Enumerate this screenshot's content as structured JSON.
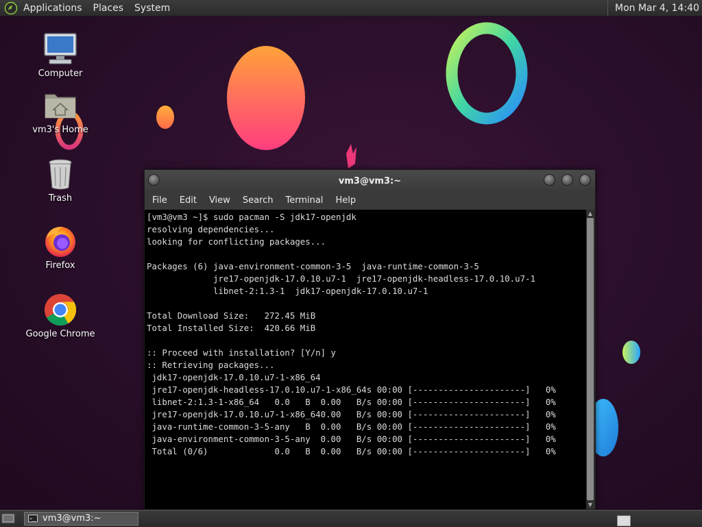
{
  "top_panel": {
    "menus": [
      "Applications",
      "Places",
      "System"
    ],
    "clock": "Mon Mar  4, 14:40"
  },
  "desktop_icons": {
    "computer": "Computer",
    "home": "vm3's Home",
    "trash": "Trash",
    "firefox": "Firefox",
    "chrome": "Google Chrome"
  },
  "terminal": {
    "title": "vm3@vm3:~",
    "menu": [
      "File",
      "Edit",
      "View",
      "Search",
      "Terminal",
      "Help"
    ],
    "lines": [
      "[vm3@vm3 ~]$ sudo pacman -S jdk17-openjdk",
      "resolving dependencies...",
      "looking for conflicting packages...",
      "",
      "Packages (6) java-environment-common-3-5  java-runtime-common-3-5",
      "             jre17-openjdk-17.0.10.u7-1  jre17-openjdk-headless-17.0.10.u7-1",
      "             libnet-2:1.3-1  jdk17-openjdk-17.0.10.u7-1",
      "",
      "Total Download Size:   272.45 MiB",
      "Total Installed Size:  420.66 MiB",
      "",
      ":: Proceed with installation? [Y/n] y",
      ":: Retrieving packages...",
      " jdk17-openjdk-17.0.10.u7-1-x86_64",
      " jre17-openjdk-headless-17.0.10.u7-1-x86_64s 00:00 [----------------------]   0%",
      " libnet-2:1.3-1-x86_64   0.0   B  0.00   B/s 00:00 [----------------------]   0%",
      " jre17-openjdk-17.0.10.u7-1-x86_640.00   B/s 00:00 [----------------------]   0%",
      " java-runtime-common-3-5-any   B  0.00   B/s 00:00 [----------------------]   0%",
      " java-environment-common-3-5-any  0.00   B/s 00:00 [----------------------]   0%",
      " Total (0/6)             0.0   B  0.00   B/s 00:00 [----------------------]   0%"
    ]
  },
  "taskbar": {
    "terminal_label": "vm3@vm3:~"
  },
  "icons": {
    "logo": "mate-logo-icon",
    "computer": "monitor-icon",
    "home": "home-folder-icon",
    "trash": "trash-icon",
    "firefox": "firefox-icon",
    "chrome": "chrome-icon",
    "show_desktop": "show-desktop-icon",
    "terminal_small": "terminal-icon"
  }
}
